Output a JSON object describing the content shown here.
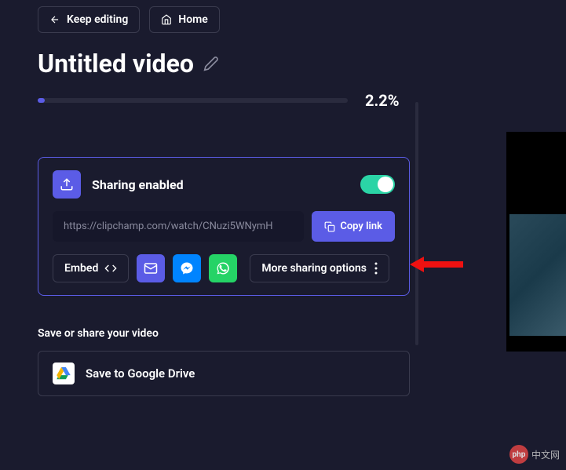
{
  "nav": {
    "keep_editing": "Keep editing",
    "home": "Home"
  },
  "title": "Untitled video",
  "progress": {
    "percent": 2.2,
    "label": "2.2%"
  },
  "sharing": {
    "title": "Sharing enabled",
    "enabled": true,
    "url": "https://clipchamp.com/watch/CNuzi5WNymH",
    "copy_label": "Copy link",
    "embed_label": "Embed",
    "more_label": "More sharing options"
  },
  "save": {
    "section_label": "Save or share your video",
    "google_drive": "Save to Google Drive"
  },
  "watermark": {
    "logo": "php",
    "text": "中文网"
  }
}
